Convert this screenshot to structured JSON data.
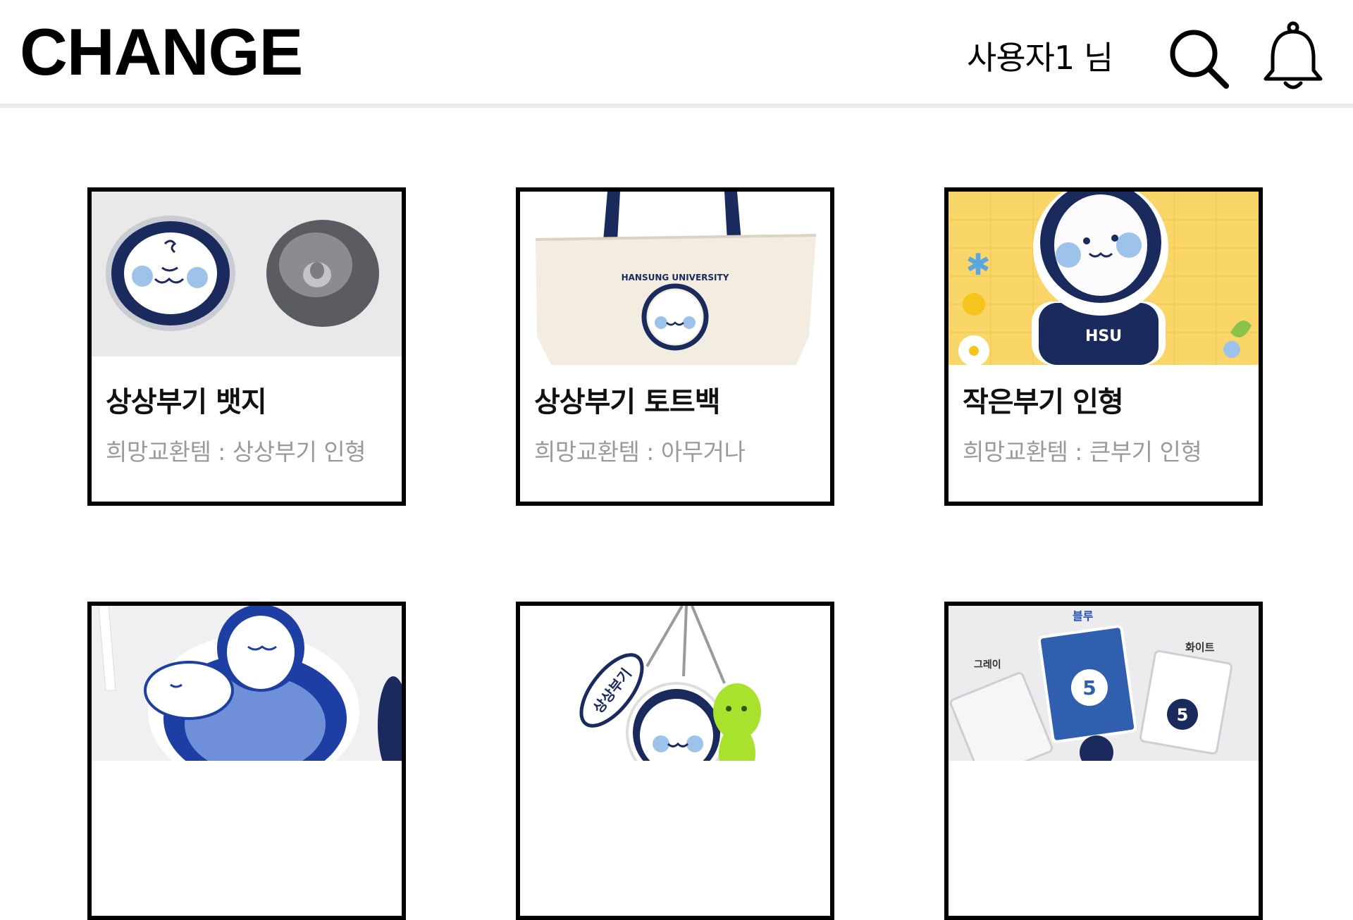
{
  "header": {
    "logo": "CHANGE",
    "username": "사용자1 님",
    "icons": [
      "search-icon",
      "bell-icon"
    ]
  },
  "items": [
    {
      "title": "상상부기 뱃지",
      "wish": "희망교환템 : 상상부기 인형",
      "image": "badge-photo"
    },
    {
      "title": "상상부기 토트백",
      "wish": "희망교환템 : 아무거나",
      "image": "tote-bag-photo"
    },
    {
      "title": "작은부기 인형",
      "wish": "희망교환템 : 큰부기 인형",
      "image": "plush-doll-photo"
    },
    {
      "image": "embroidered-patch-photo"
    },
    {
      "image": "acrylic-keychain-photo"
    },
    {
      "image": "sticker-packs-photo"
    }
  ],
  "images": {
    "bag_text": "HANSUNG UNIVERSITY",
    "shirt_text": "HSU",
    "keychain_text": "상상부기",
    "sticker_top": "블루",
    "sticker_left": "그레이",
    "sticker_right": "화이트"
  },
  "colors": {
    "navy": "#1b2a5c",
    "light_blue": "#9ec3ea",
    "yellow_bg": "#f9d667",
    "divider": "#ececec",
    "subtext": "#9a9a9a"
  }
}
